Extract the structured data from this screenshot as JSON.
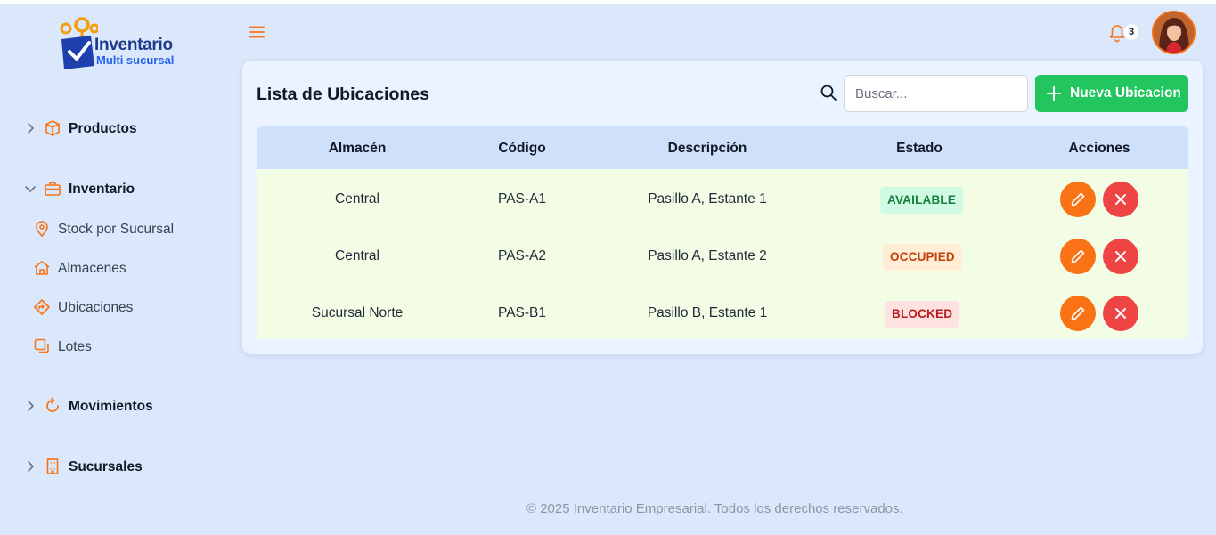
{
  "brand": {
    "title": "Inventario",
    "subtitle": "Multi sucursal"
  },
  "sidebar": {
    "groups": [
      {
        "label": "Productos",
        "icon": "box-icon",
        "expanded": false
      },
      {
        "label": "Inventario",
        "icon": "briefcase-icon",
        "expanded": true,
        "items": [
          {
            "label": "Stock por Sucursal",
            "icon": "map-pin-icon"
          },
          {
            "label": "Almacenes",
            "icon": "warehouse-icon"
          },
          {
            "label": "Ubicaciones",
            "icon": "directions-icon"
          },
          {
            "label": "Lotes",
            "icon": "copy-icon"
          }
        ]
      },
      {
        "label": "Movimientos",
        "icon": "refresh-icon",
        "expanded": false
      },
      {
        "label": "Sucursales",
        "icon": "building-icon",
        "expanded": false
      }
    ]
  },
  "topbar": {
    "notifications_count": "3"
  },
  "page": {
    "title": "Lista de Ubicaciones",
    "search_placeholder": "Buscar...",
    "new_button": "Nueva Ubicacion"
  },
  "table": {
    "headers": [
      "Almacén",
      "Código",
      "Descripción",
      "Estado",
      "Acciones"
    ],
    "rows": [
      {
        "almacen": "Central",
        "codigo": "PAS-A1",
        "descripcion": "Pasillo A, Estante 1",
        "estado": "AVAILABLE"
      },
      {
        "almacen": "Central",
        "codigo": "PAS-A2",
        "descripcion": "Pasillo A, Estante 2",
        "estado": "OCCUPIED"
      },
      {
        "almacen": "Sucursal Norte",
        "codigo": "PAS-B1",
        "descripcion": "Pasillo B, Estante 1",
        "estado": "BLOCKED"
      }
    ]
  },
  "footer": {
    "text": "© 2025 Inventario Empresarial. Todos los derechos reservados."
  },
  "colors": {
    "accent": "#f97316",
    "primary_button": "#22c55e",
    "delete": "#ef4444",
    "background": "#dbe8fb"
  }
}
